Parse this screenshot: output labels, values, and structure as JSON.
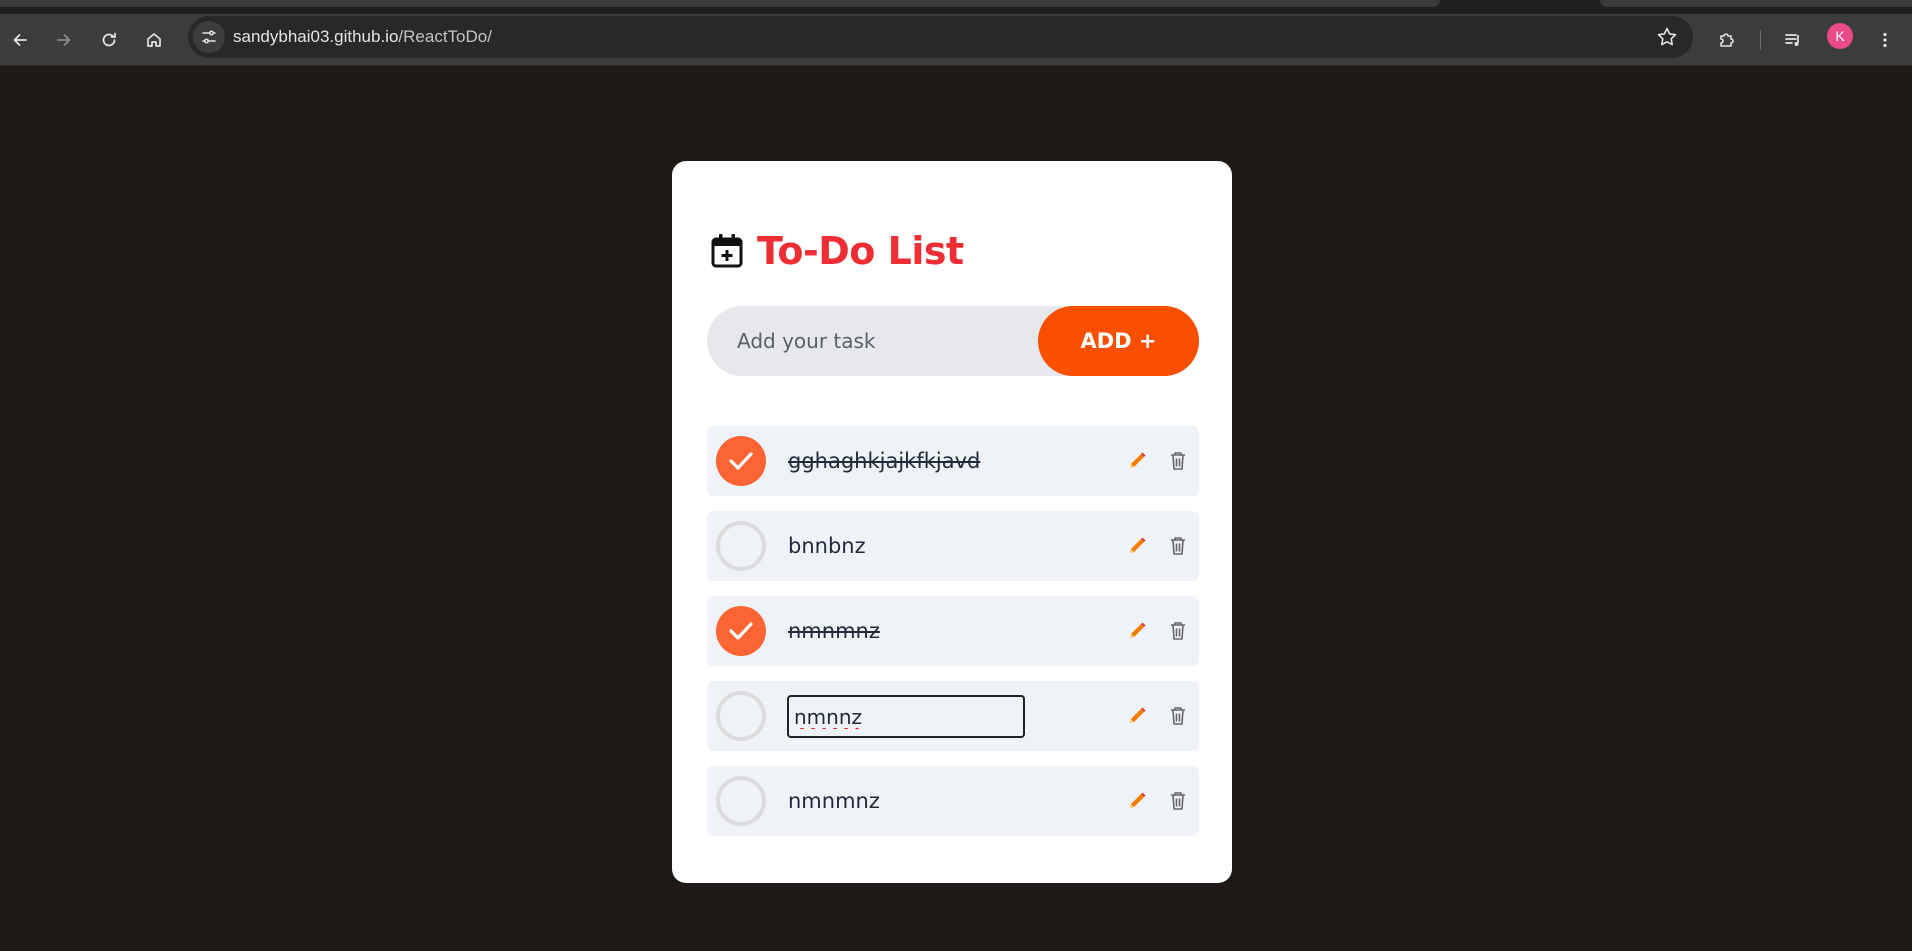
{
  "browser": {
    "url_host": "sandybhai03.github.io",
    "url_path": "/ReactToDo/",
    "profile_initial": "K"
  },
  "app": {
    "title": "To-Do List",
    "input_placeholder": "Add your task",
    "add_button_label": "ADD +",
    "accent_color": "#fb4f00",
    "title_color": "#ee2d35"
  },
  "todos": [
    {
      "text": "gghaghkjajkfkjavd",
      "completed": true
    },
    {
      "text": "bnnbnz",
      "completed": false
    },
    {
      "text": "nmnmnz",
      "completed": true
    },
    {
      "text": "nmnnz",
      "completed": false,
      "editing": true
    },
    {
      "text": "nmnmnz",
      "completed": false
    }
  ]
}
